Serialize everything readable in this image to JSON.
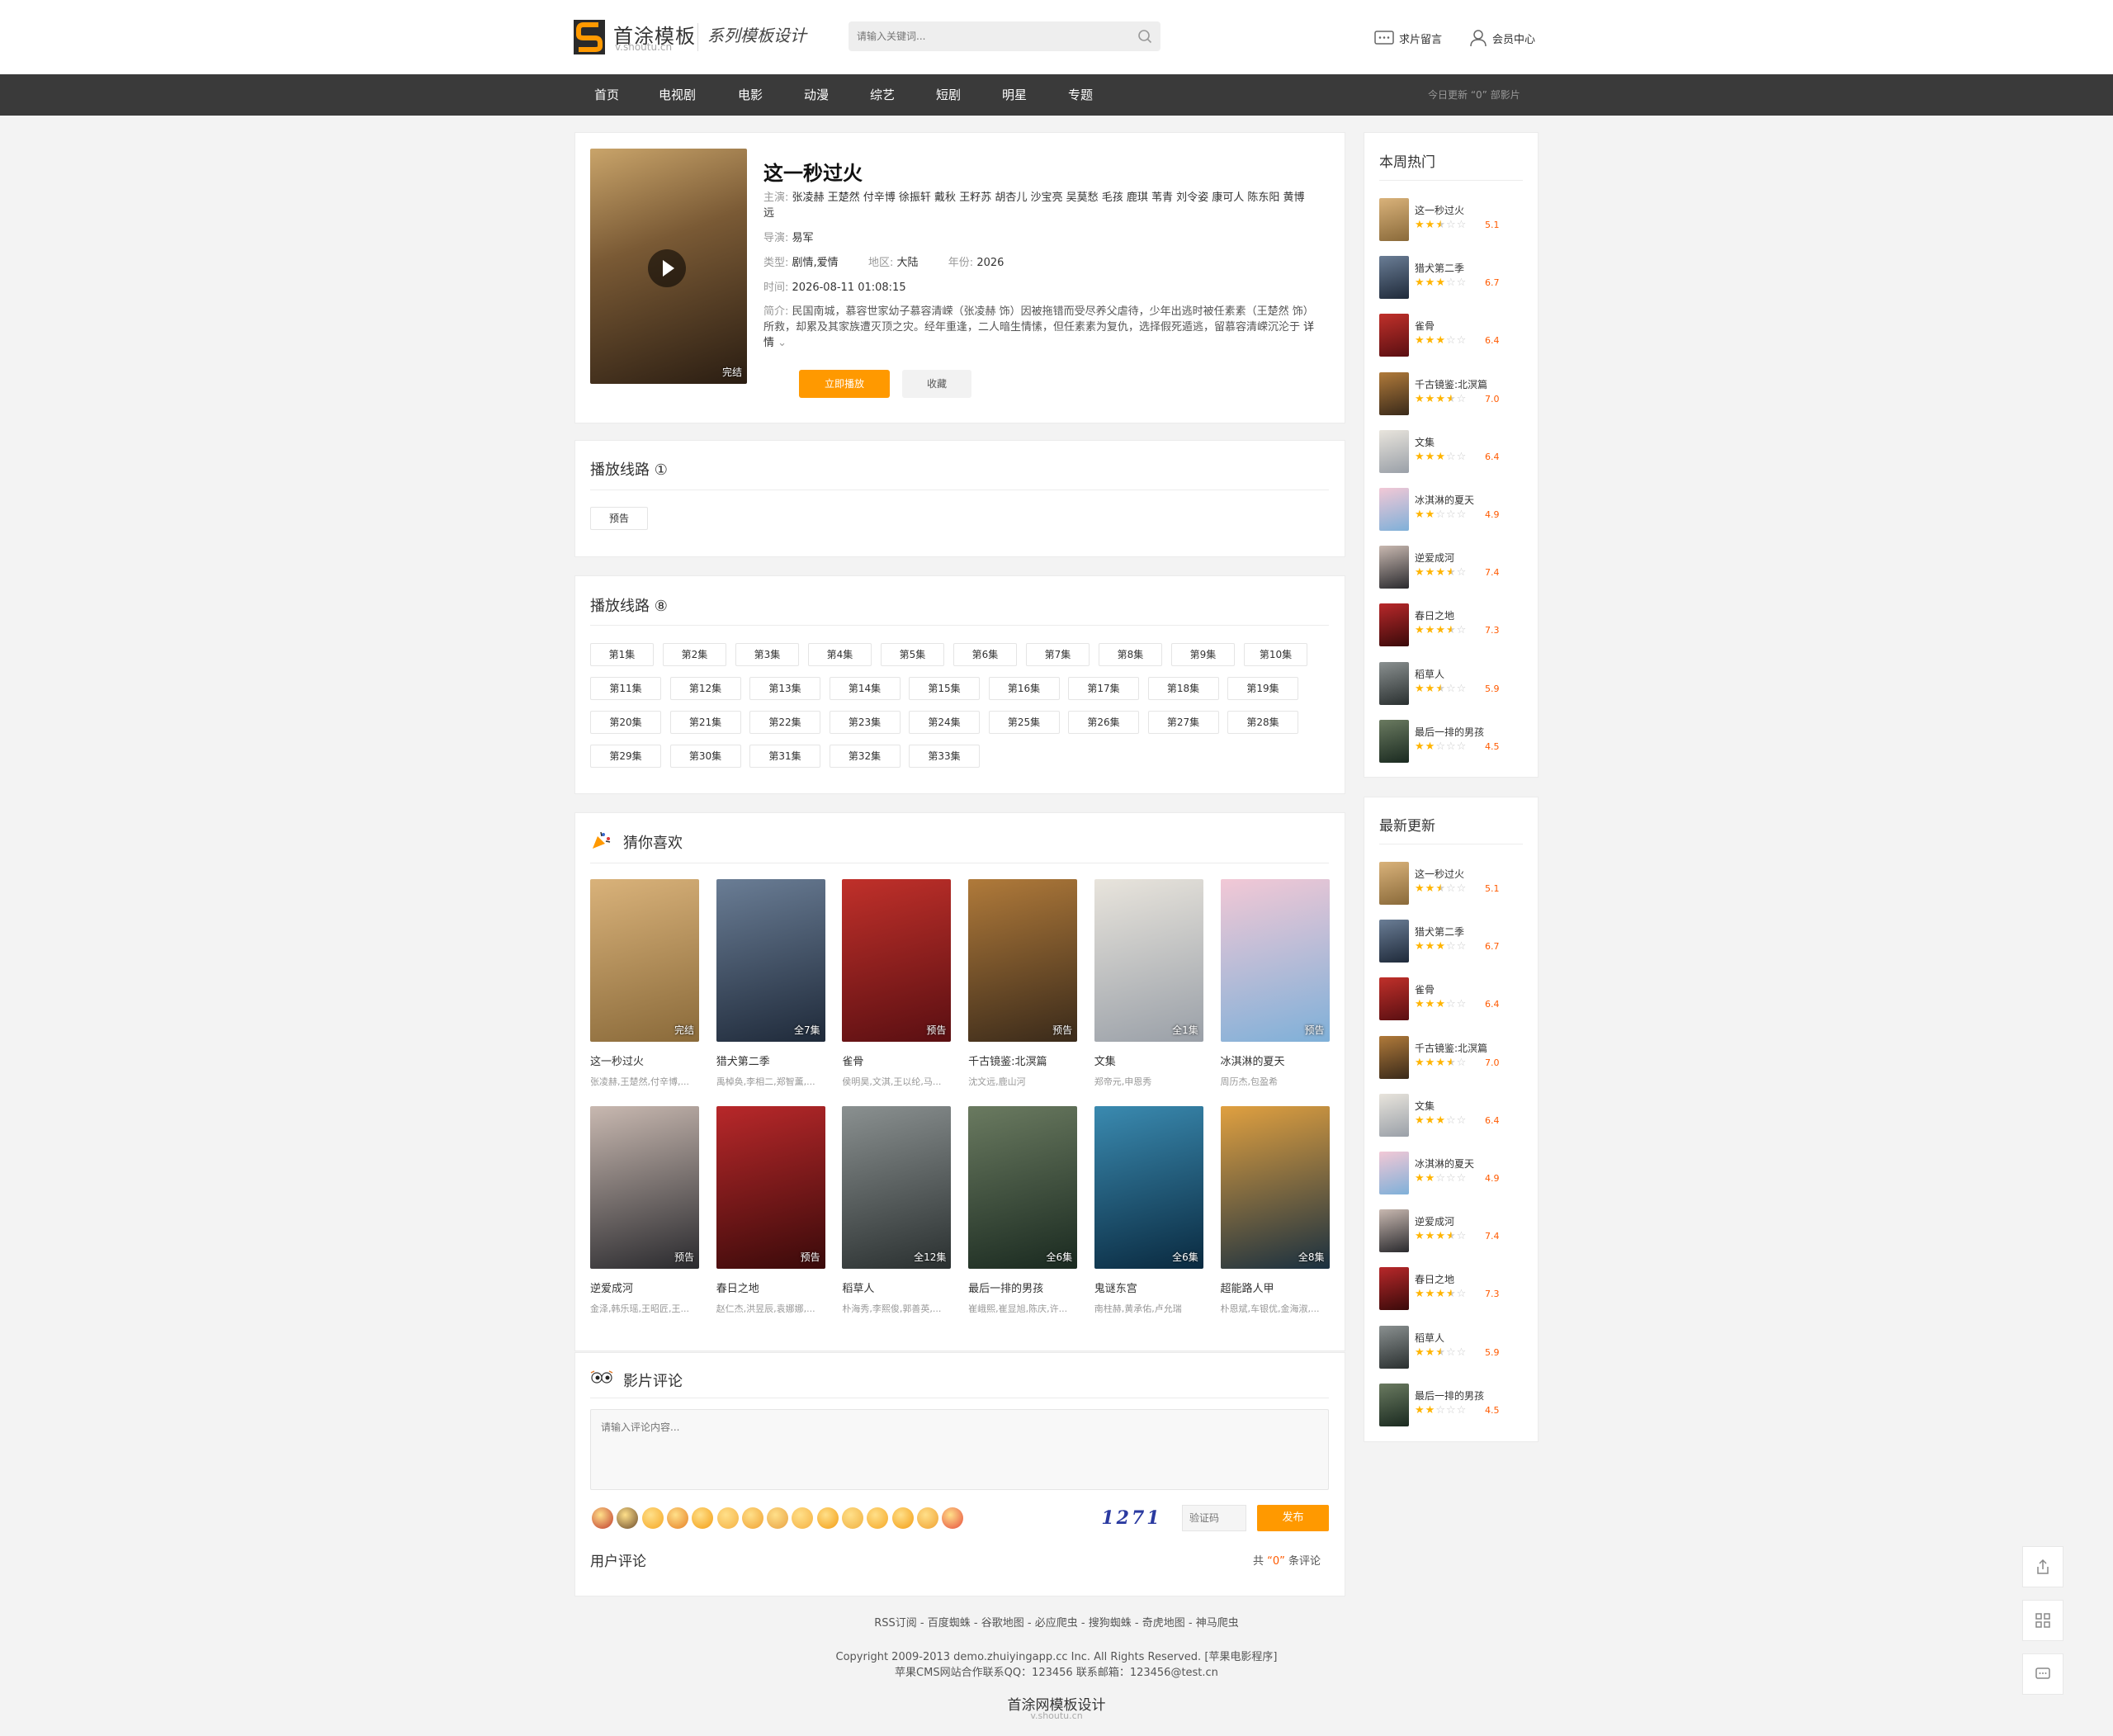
{
  "brand": {
    "name": "首涂模板",
    "domain": "v.shoutu.cn",
    "slogan": "系列模板设计",
    "accent": "#ff9900",
    "nav_bg": "#3a3a3a"
  },
  "search": {
    "placeholder": "请输入关键词..."
  },
  "toplinks": {
    "request": "求片留言",
    "member": "会员中心"
  },
  "nav": {
    "items": [
      "首页",
      "电视剧",
      "电影",
      "动漫",
      "综艺",
      "短剧",
      "明星",
      "专题"
    ],
    "update": "今日更新 “0” 部影片"
  },
  "detail": {
    "title": "这一秒过火",
    "poster_tag": "完结",
    "cast_label": "主演:",
    "cast": "张凌赫 王楚然 付辛博 徐振轩 戴秋 王籽苏 胡杏儿 沙宝亮 吴莫愁 毛孩 鹿琪 苇青 刘令姿 康可人 陈东阳 黄博远",
    "director_label": "导演:",
    "director": "易军",
    "type_label": "类型:",
    "type": "剧情,爱情",
    "region_label": "地区:",
    "region": "大陆",
    "year_label": "年份:",
    "year": "2026",
    "time_label": "时间:",
    "time": "2026-08-11 01:08:15",
    "intro_label": "简介:",
    "intro": "民国南城，慕容世家幼子慕容清嵘（张凌赫 饰）因被拖错而受尽养父虐待，少年出逃时被任素素（王楚然 饰）所救，却累及其家族遭灭顶之灾。经年重逢，二人暗生情愫，但任素素为复仇，选择假死遁逃，留慕容清嵘沉沦于",
    "more": "详情",
    "play_btn": "立即播放",
    "fav_btn": "收藏"
  },
  "playlist1": {
    "title": "播放线路",
    "num": "①",
    "episodes": [
      "预告"
    ]
  },
  "playlist2": {
    "title": "播放线路",
    "num": "⑧",
    "episodes": [
      "第1集",
      "第2集",
      "第3集",
      "第4集",
      "第5集",
      "第6集",
      "第7集",
      "第8集",
      "第9集",
      "第10集",
      "第11集",
      "第12集",
      "第13集",
      "第14集",
      "第15集",
      "第16集",
      "第17集",
      "第18集",
      "第19集",
      "第20集",
      "第21集",
      "第22集",
      "第23集",
      "第24集",
      "第25集",
      "第26集",
      "第27集",
      "第28集",
      "第29集",
      "第30集",
      "第31集",
      "第32集",
      "第33集"
    ]
  },
  "recommend": {
    "title": "猜你喜欢",
    "items": [
      {
        "title": "这一秒过火",
        "actors": "张凌赫,王楚然,付辛博,...",
        "tag": "完结",
        "c1": "#8a6a3a",
        "c2": "#d9b27a"
      },
      {
        "title": "猎犬第二季",
        "actors": "禹棹奂,李相二,郑智薰,...",
        "tag": "全7集",
        "c1": "#1f2a3a",
        "c2": "#6a7d95"
      },
      {
        "title": "雀骨",
        "actors": "侯明昊,文淇,王以纶,马...",
        "tag": "预告",
        "c1": "#5a0f12",
        "c2": "#c0302a"
      },
      {
        "title": "千古镜鉴:北溟篇",
        "actors": "沈文远,鹿山河",
        "tag": "预告",
        "c1": "#3a2a1a",
        "c2": "#b07a3a"
      },
      {
        "title": "文集",
        "actors": "郑帝元,申恩秀",
        "tag": "全1集",
        "c1": "#9aa0a8",
        "c2": "#e8e4dc"
      },
      {
        "title": "冰淇淋的夏天",
        "actors": "周历杰,包盈希",
        "tag": "预告",
        "c1": "#7fb0d8",
        "c2": "#f2c8d6"
      },
      {
        "title": "逆爱成河",
        "actors": "金泽,韩乐瑶,王昭匠,王...",
        "tag": "预告",
        "c1": "#2a2a2e",
        "c2": "#c8b8b0"
      },
      {
        "title": "春日之地",
        "actors": "赵仁杰,洪昱辰,袁娜娜,...",
        "tag": "预告",
        "c1": "#3a0a0a",
        "c2": "#b8282a"
      },
      {
        "title": "稻草人",
        "actors": "朴海秀,李熙俊,郭善英,...",
        "tag": "全12集",
        "c1": "#2a3030",
        "c2": "#8a9090"
      },
      {
        "title": "最后一排的男孩",
        "actors": "崔峨熙,崔显旭,陈庆,许...",
        "tag": "全6集",
        "c1": "#1a2a20",
        "c2": "#6a7a60"
      },
      {
        "title": "鬼谜东宫",
        "actors": "南柱赫,黄承佑,卢允瑞",
        "tag": "全6集",
        "c1": "#0a2a40",
        "c2": "#3a8ab0"
      },
      {
        "title": "超能路人甲",
        "actors": "朴恩斌,车银优,金海淑,...",
        "tag": "全8集",
        "c1": "#1a3040",
        "c2": "#e0a040"
      }
    ]
  },
  "comments": {
    "title": "影片评论",
    "placeholder": "请输入评论内容...",
    "captcha": "1271",
    "captcha_placeholder": "验证码",
    "post": "发布",
    "user_title": "用户评论",
    "count_prefix": "共",
    "count": "“0”",
    "count_suffix": "条评论"
  },
  "sidebar": {
    "hot_title": "本周热门",
    "new_title": "最新更新",
    "items": [
      {
        "title": "这一秒过火",
        "score": "5.1",
        "rating": 2.5,
        "c1": "#8a6a3a",
        "c2": "#d9b27a"
      },
      {
        "title": "猎犬第二季",
        "score": "6.7",
        "rating": 3,
        "c1": "#1f2a3a",
        "c2": "#6a7d95"
      },
      {
        "title": "雀骨",
        "score": "6.4",
        "rating": 3,
        "c1": "#5a0f12",
        "c2": "#c0302a"
      },
      {
        "title": "千古镜鉴:北溟篇",
        "score": "7.0",
        "rating": 3.5,
        "c1": "#3a2a1a",
        "c2": "#b07a3a"
      },
      {
        "title": "文集",
        "score": "6.4",
        "rating": 3,
        "c1": "#9aa0a8",
        "c2": "#e8e4dc"
      },
      {
        "title": "冰淇淋的夏天",
        "score": "4.9",
        "rating": 2,
        "c1": "#7fb0d8",
        "c2": "#f2c8d6"
      },
      {
        "title": "逆爱成河",
        "score": "7.4",
        "rating": 3.5,
        "c1": "#2a2a2e",
        "c2": "#c8b8b0"
      },
      {
        "title": "春日之地",
        "score": "7.3",
        "rating": 3.5,
        "c1": "#3a0a0a",
        "c2": "#b8282a"
      },
      {
        "title": "稻草人",
        "score": "5.9",
        "rating": 2.5,
        "c1": "#2a3030",
        "c2": "#8a9090"
      },
      {
        "title": "最后一排的男孩",
        "score": "4.5",
        "rating": 2,
        "c1": "#1a2a20",
        "c2": "#6a7a60"
      }
    ]
  },
  "footer": {
    "links": [
      "RSS订阅",
      "百度蜘蛛",
      "谷歌地图",
      "必应爬虫",
      "搜狗蜘蛛",
      "奇虎地图",
      "神马爬虫"
    ],
    "sep": "-",
    "copyright": "Copyright 2009-2013 demo.zhuiyingapp.cc Inc. All Rights Reserved. [苹果电影程序]",
    "contact": "苹果CMS网站合作联系QQ：123456 联系邮箱：123456@test.cn",
    "brand_main": "首涂网模板设计",
    "brand_sub": "v.shoutu.cn"
  }
}
